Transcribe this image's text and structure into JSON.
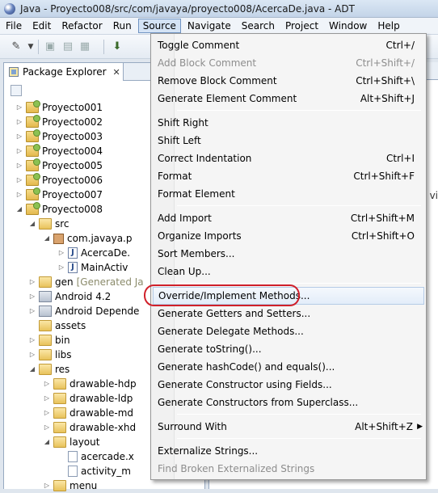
{
  "window": {
    "title": "Java - Proyecto008/src/com/javaya/proyecto008/AcercaDe.java - ADT"
  },
  "menubar": [
    "File",
    "Edit",
    "Refactor",
    "Run",
    "Source",
    "Navigate",
    "Search",
    "Project",
    "Window",
    "Help"
  ],
  "package_explorer": {
    "tab_label": "Package Explorer",
    "close_glyph": "✕",
    "tree": [
      {
        "label": "Proyecto001",
        "icon": "project-icon",
        "expanded": false
      },
      {
        "label": "Proyecto002",
        "icon": "project-icon",
        "expanded": false
      },
      {
        "label": "Proyecto003",
        "icon": "project-icon",
        "expanded": false
      },
      {
        "label": "Proyecto004",
        "icon": "project-icon",
        "expanded": false
      },
      {
        "label": "Proyecto005",
        "icon": "project-icon",
        "expanded": false
      },
      {
        "label": "Proyecto006",
        "icon": "project-icon",
        "expanded": false
      },
      {
        "label": "Proyecto007",
        "icon": "project-icon",
        "expanded": false
      },
      {
        "label": "Proyecto008",
        "icon": "project-icon",
        "expanded": true
      },
      {
        "label": "src",
        "icon": "source-folder-icon",
        "expanded": true
      },
      {
        "label": "com.javaya.p",
        "icon": "package-icon",
        "expanded": true
      },
      {
        "label": "AcercaDe.",
        "icon": "java-file-icon",
        "expanded": false
      },
      {
        "label": "MainActiv",
        "icon": "java-file-icon",
        "expanded": false
      },
      {
        "label": "gen",
        "extra": "[Generated Ja",
        "icon": "folder-icon",
        "expanded": false
      },
      {
        "label": "Android 4.2",
        "icon": "library-icon",
        "expanded": false
      },
      {
        "label": "Android Depende",
        "icon": "library-icon",
        "expanded": false
      },
      {
        "label": "assets",
        "icon": "folder-icon",
        "expanded": null
      },
      {
        "label": "bin",
        "icon": "folder-icon",
        "expanded": false
      },
      {
        "label": "libs",
        "icon": "folder-icon",
        "expanded": false
      },
      {
        "label": "res",
        "icon": "folder-icon",
        "expanded": true
      },
      {
        "label": "drawable-hdp",
        "icon": "folder-icon",
        "expanded": false
      },
      {
        "label": "drawable-ldp",
        "icon": "folder-icon",
        "expanded": false
      },
      {
        "label": "drawable-md",
        "icon": "folder-icon",
        "expanded": false
      },
      {
        "label": "drawable-xhd",
        "icon": "folder-icon",
        "expanded": false
      },
      {
        "label": "layout",
        "icon": "folder-icon",
        "expanded": true
      },
      {
        "label": "acercade.x",
        "icon": "xml-file-icon",
        "expanded": null
      },
      {
        "label": "activity_m",
        "icon": "xml-file-icon",
        "expanded": null
      },
      {
        "label": "menu",
        "icon": "folder-icon",
        "expanded": false
      }
    ]
  },
  "editor": {
    "fragment": "vi"
  },
  "source_menu": {
    "groups": [
      [
        {
          "label": "Toggle Comment",
          "accel": "Ctrl+/",
          "disabled": false
        },
        {
          "label": "Add Block Comment",
          "accel": "Ctrl+Shift+/",
          "disabled": true
        },
        {
          "label": "Remove Block Comment",
          "accel": "Ctrl+Shift+\\",
          "disabled": false
        },
        {
          "label": "Generate Element Comment",
          "accel": "Alt+Shift+J",
          "disabled": false
        }
      ],
      [
        {
          "label": "Shift Right",
          "accel": "",
          "disabled": false
        },
        {
          "label": "Shift Left",
          "accel": "",
          "disabled": false
        },
        {
          "label": "Correct Indentation",
          "accel": "Ctrl+I",
          "disabled": false
        },
        {
          "label": "Format",
          "accel": "Ctrl+Shift+F",
          "disabled": false
        },
        {
          "label": "Format Element",
          "accel": "",
          "disabled": false
        }
      ],
      [
        {
          "label": "Add Import",
          "accel": "Ctrl+Shift+M",
          "disabled": false
        },
        {
          "label": "Organize Imports",
          "accel": "Ctrl+Shift+O",
          "disabled": false
        },
        {
          "label": "Sort Members...",
          "accel": "",
          "disabled": false
        },
        {
          "label": "Clean Up...",
          "accel": "",
          "disabled": false
        }
      ],
      [
        {
          "label": "Override/Implement Methods...",
          "accel": "",
          "disabled": false,
          "highlighted": true
        },
        {
          "label": "Generate Getters and Setters...",
          "accel": "",
          "disabled": false
        },
        {
          "label": "Generate Delegate Methods...",
          "accel": "",
          "disabled": false
        },
        {
          "label": "Generate toString()...",
          "accel": "",
          "disabled": false
        },
        {
          "label": "Generate hashCode() and equals()...",
          "accel": "",
          "disabled": false
        },
        {
          "label": "Generate Constructor using Fields...",
          "accel": "",
          "disabled": false
        },
        {
          "label": "Generate Constructors from Superclass...",
          "accel": "",
          "disabled": false
        }
      ],
      [
        {
          "label": "Surround With",
          "accel": "Alt+Shift+Z",
          "disabled": false,
          "submenu": true
        }
      ],
      [
        {
          "label": "Externalize Strings...",
          "accel": "",
          "disabled": false
        },
        {
          "label": "Find Broken Externalized Strings",
          "accel": "",
          "disabled": true
        }
      ]
    ]
  },
  "colors": {
    "annotation_oval": "#d0202a",
    "menu_highlight": "#e3edf9"
  }
}
